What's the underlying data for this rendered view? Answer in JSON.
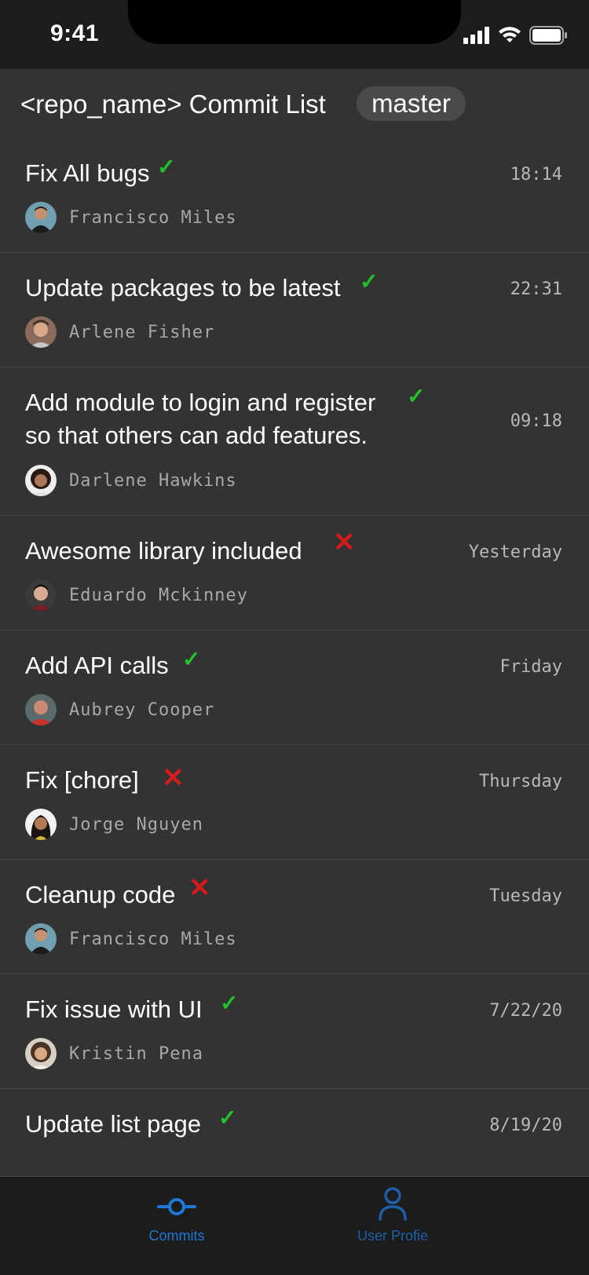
{
  "status_bar": {
    "time": "9:41"
  },
  "header": {
    "title": "<repo_name> Commit List",
    "branch": "master"
  },
  "commits": [
    {
      "title": "Fix All bugs",
      "status": "success",
      "time": "18:14",
      "author": "Francisco Miles"
    },
    {
      "title": "Update packages to be latest",
      "status": "success",
      "time": "22:31",
      "author": "Arlene Fisher"
    },
    {
      "title": "Add module to login and register\nso that others can add features.",
      "status": "success",
      "time": "09:18",
      "author": "Darlene Hawkins"
    },
    {
      "title": "Awesome library included",
      "status": "failure",
      "time": "Yesterday",
      "author": "Eduardo Mckinney"
    },
    {
      "title": "Add API calls",
      "status": "success",
      "time": "Friday",
      "author": "Aubrey Cooper"
    },
    {
      "title": "Fix [chore]",
      "status": "failure",
      "time": "Thursday",
      "author": "Jorge Nguyen"
    },
    {
      "title": "Cleanup code",
      "status": "failure",
      "time": "Tuesday",
      "author": "Francisco Miles"
    },
    {
      "title": "Fix issue with UI",
      "status": "success",
      "time": "7/22/20",
      "author": "Kristin Pena"
    },
    {
      "title": "Update list page",
      "status": "success",
      "time": "8/19/20",
      "author": ""
    }
  ],
  "status_glyphs": {
    "success": "✓",
    "failure": "✕"
  },
  "colors": {
    "success": "#22c02a",
    "failure": "#d41c1c",
    "accent": "#1e78d8"
  },
  "tabs": [
    {
      "label": "Commits",
      "icon": "commit-icon",
      "active": true
    },
    {
      "label": "User Profie",
      "icon": "user-icon",
      "active": false
    }
  ]
}
